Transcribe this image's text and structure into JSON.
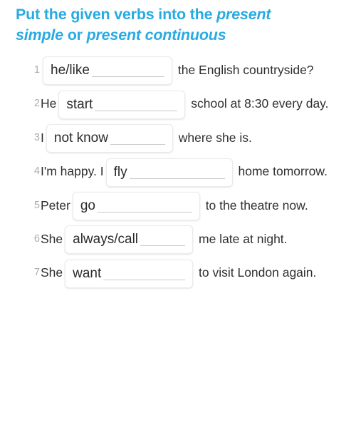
{
  "page": {
    "background_color": "#ffffff",
    "accent_color": "#29abe2",
    "body_text_color": "#2f2f2f",
    "number_color": "#adadad"
  },
  "title": {
    "line1_part1": "Put the given verbs into the ",
    "line1_part2_italic": "present",
    "line2_part1_italic": "simple",
    "line2_part2": " or ",
    "line2_part3_italic": "present continuous"
  },
  "exercises": [
    {
      "number": "1",
      "before": "",
      "answer": "he/like",
      "after": " the English countryside?"
    },
    {
      "number": "2",
      "before": "He",
      "answer": "start",
      "after": " school at 8:30 every day."
    },
    {
      "number": "3",
      "before": "I",
      "answer": "not know",
      "after": " where she is."
    },
    {
      "number": "4",
      "before": "I'm happy. I",
      "answer": "fly",
      "after": " home tomorrow."
    },
    {
      "number": "5",
      "before": "Peter",
      "answer": "go",
      "after": " to the theatre now."
    },
    {
      "number": "6",
      "before": "She",
      "answer": "always/call",
      "after": " me late at night."
    },
    {
      "number": "7",
      "before": "She",
      "answer": "want",
      "after": " to visit London again."
    }
  ]
}
